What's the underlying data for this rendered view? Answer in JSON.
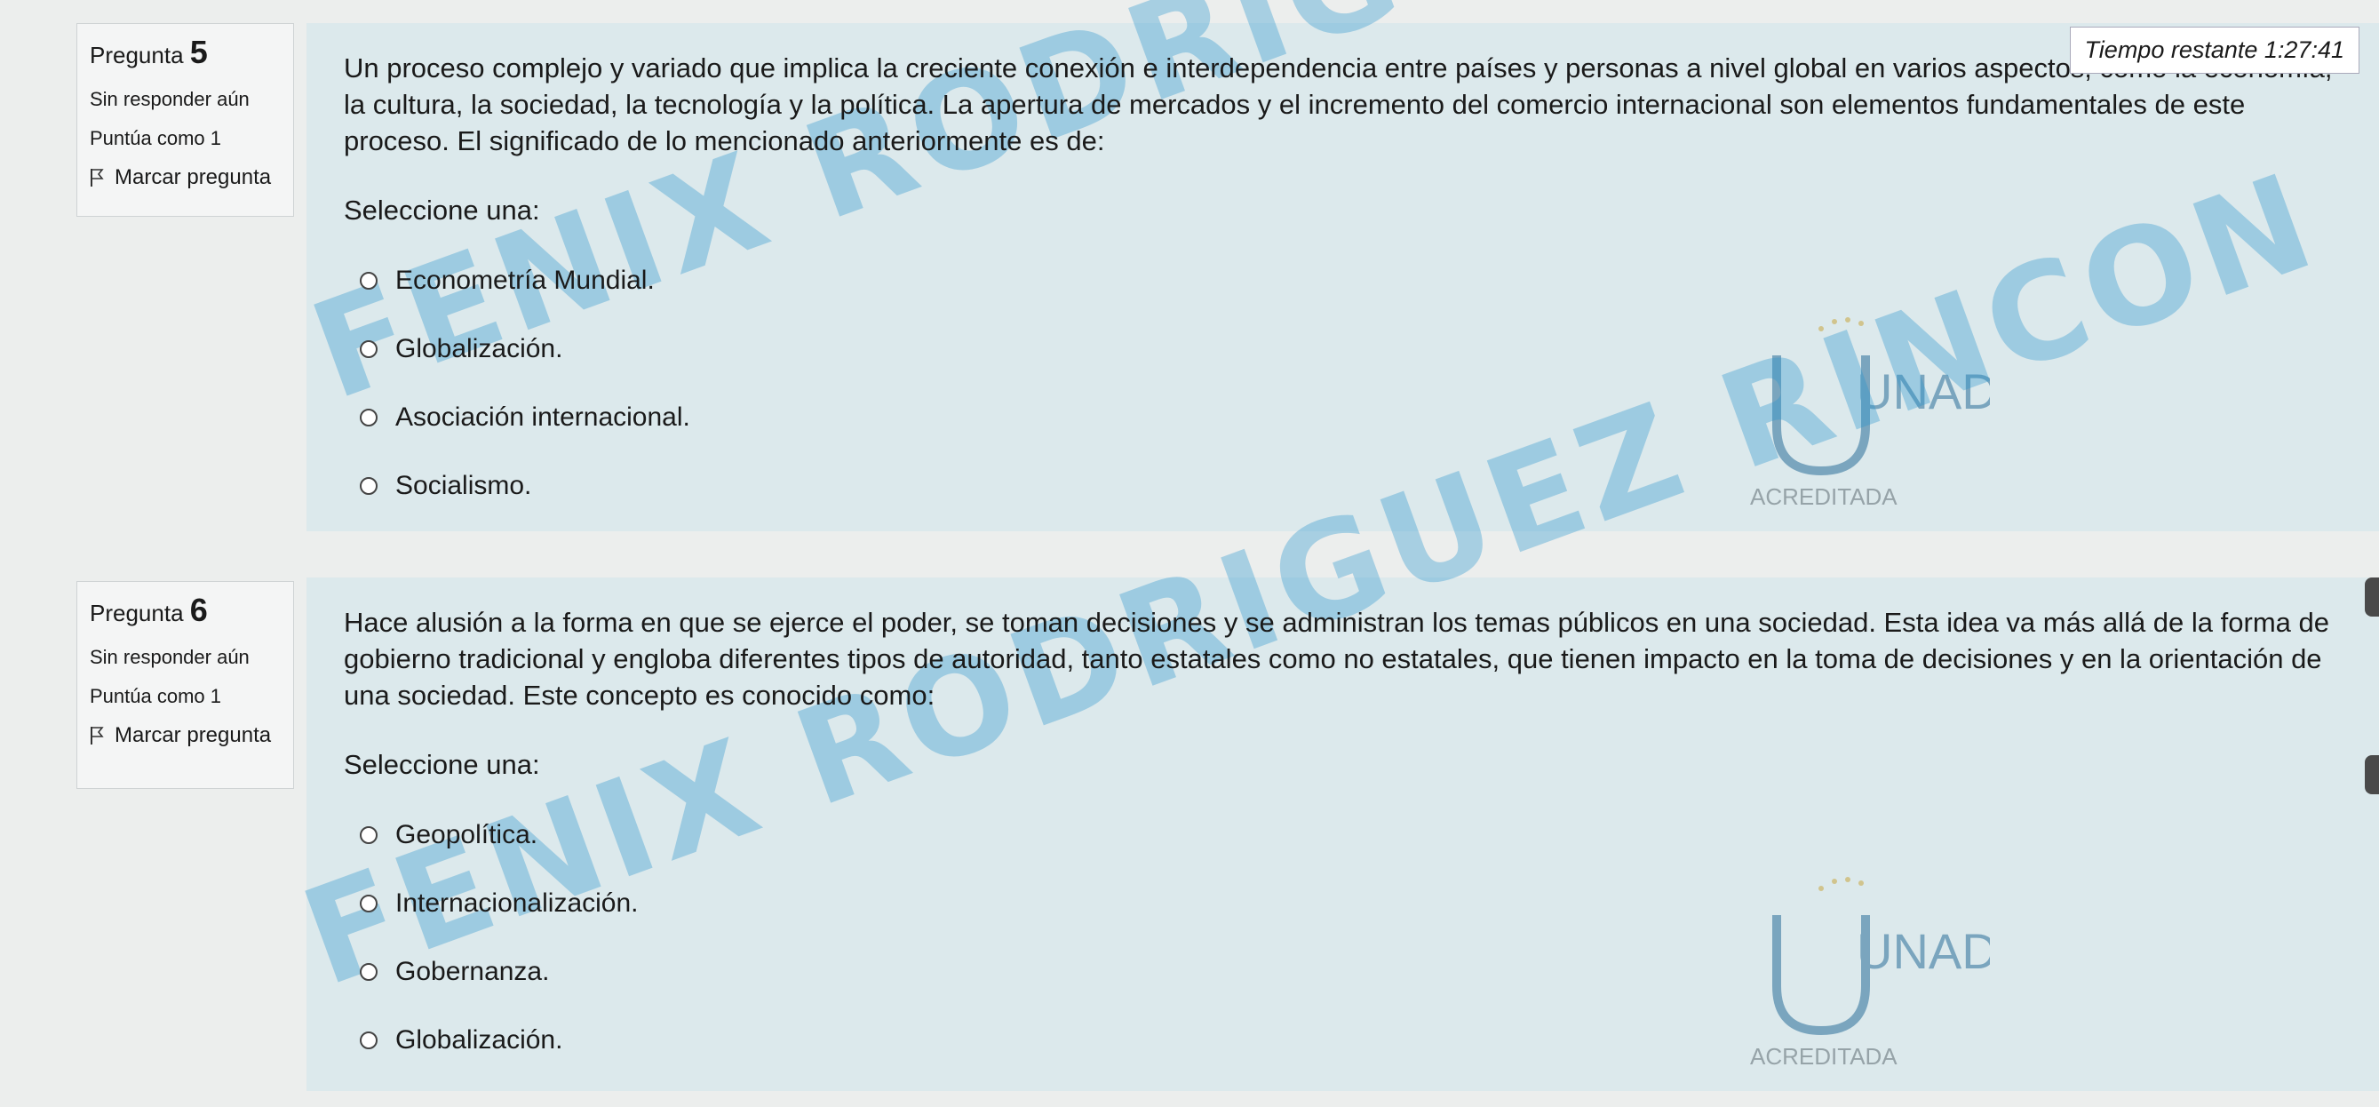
{
  "timer": {
    "label": "Tiempo restante 1:27:41"
  },
  "watermark": "FENIX RODRIGUEZ RINCON",
  "questions": [
    {
      "label": "Pregunta",
      "number": "5",
      "status": "Sin responder aún",
      "score": "Puntúa como 1",
      "flag_label": "Marcar pregunta",
      "text": "Un proceso complejo y variado que implica la creciente conexión e interdependencia entre países y personas a nivel global en varios aspectos, como la economía, la cultura, la sociedad, la tecnología y la política. La apertura de mercados y el incremento del comercio internacional son elementos fundamentales de este proceso. El significado de lo mencionado anteriormente es de:",
      "prompt": "Seleccione una:",
      "options": [
        "Econometría Mundial.",
        "Globalización.",
        "Asociación internacional.",
        "Socialismo."
      ]
    },
    {
      "label": "Pregunta",
      "number": "6",
      "status": "Sin responder aún",
      "score": "Puntúa como 1",
      "flag_label": "Marcar pregunta",
      "text": "Hace alusión a la forma en que se ejerce el poder, se toman decisiones y se administran los temas públicos en una sociedad. Esta idea va más allá de la forma de gobierno tradicional y engloba diferentes tipos de autoridad, tanto estatales como no estatales, que tienen impacto en la toma de decisiones y en la orientación de una sociedad. Este concepto es conocido como:",
      "prompt": "Seleccione una:",
      "options": [
        "Geopolítica.",
        "Internacionalización.",
        "Gobernanza.",
        "Globalización."
      ]
    }
  ],
  "logo": {
    "name": "UNAD",
    "caption": "ACREDITADA"
  },
  "colors": {
    "content_bg": "#dce9ec",
    "watermark": "#2896cd",
    "page_bg": "#eceeed"
  }
}
